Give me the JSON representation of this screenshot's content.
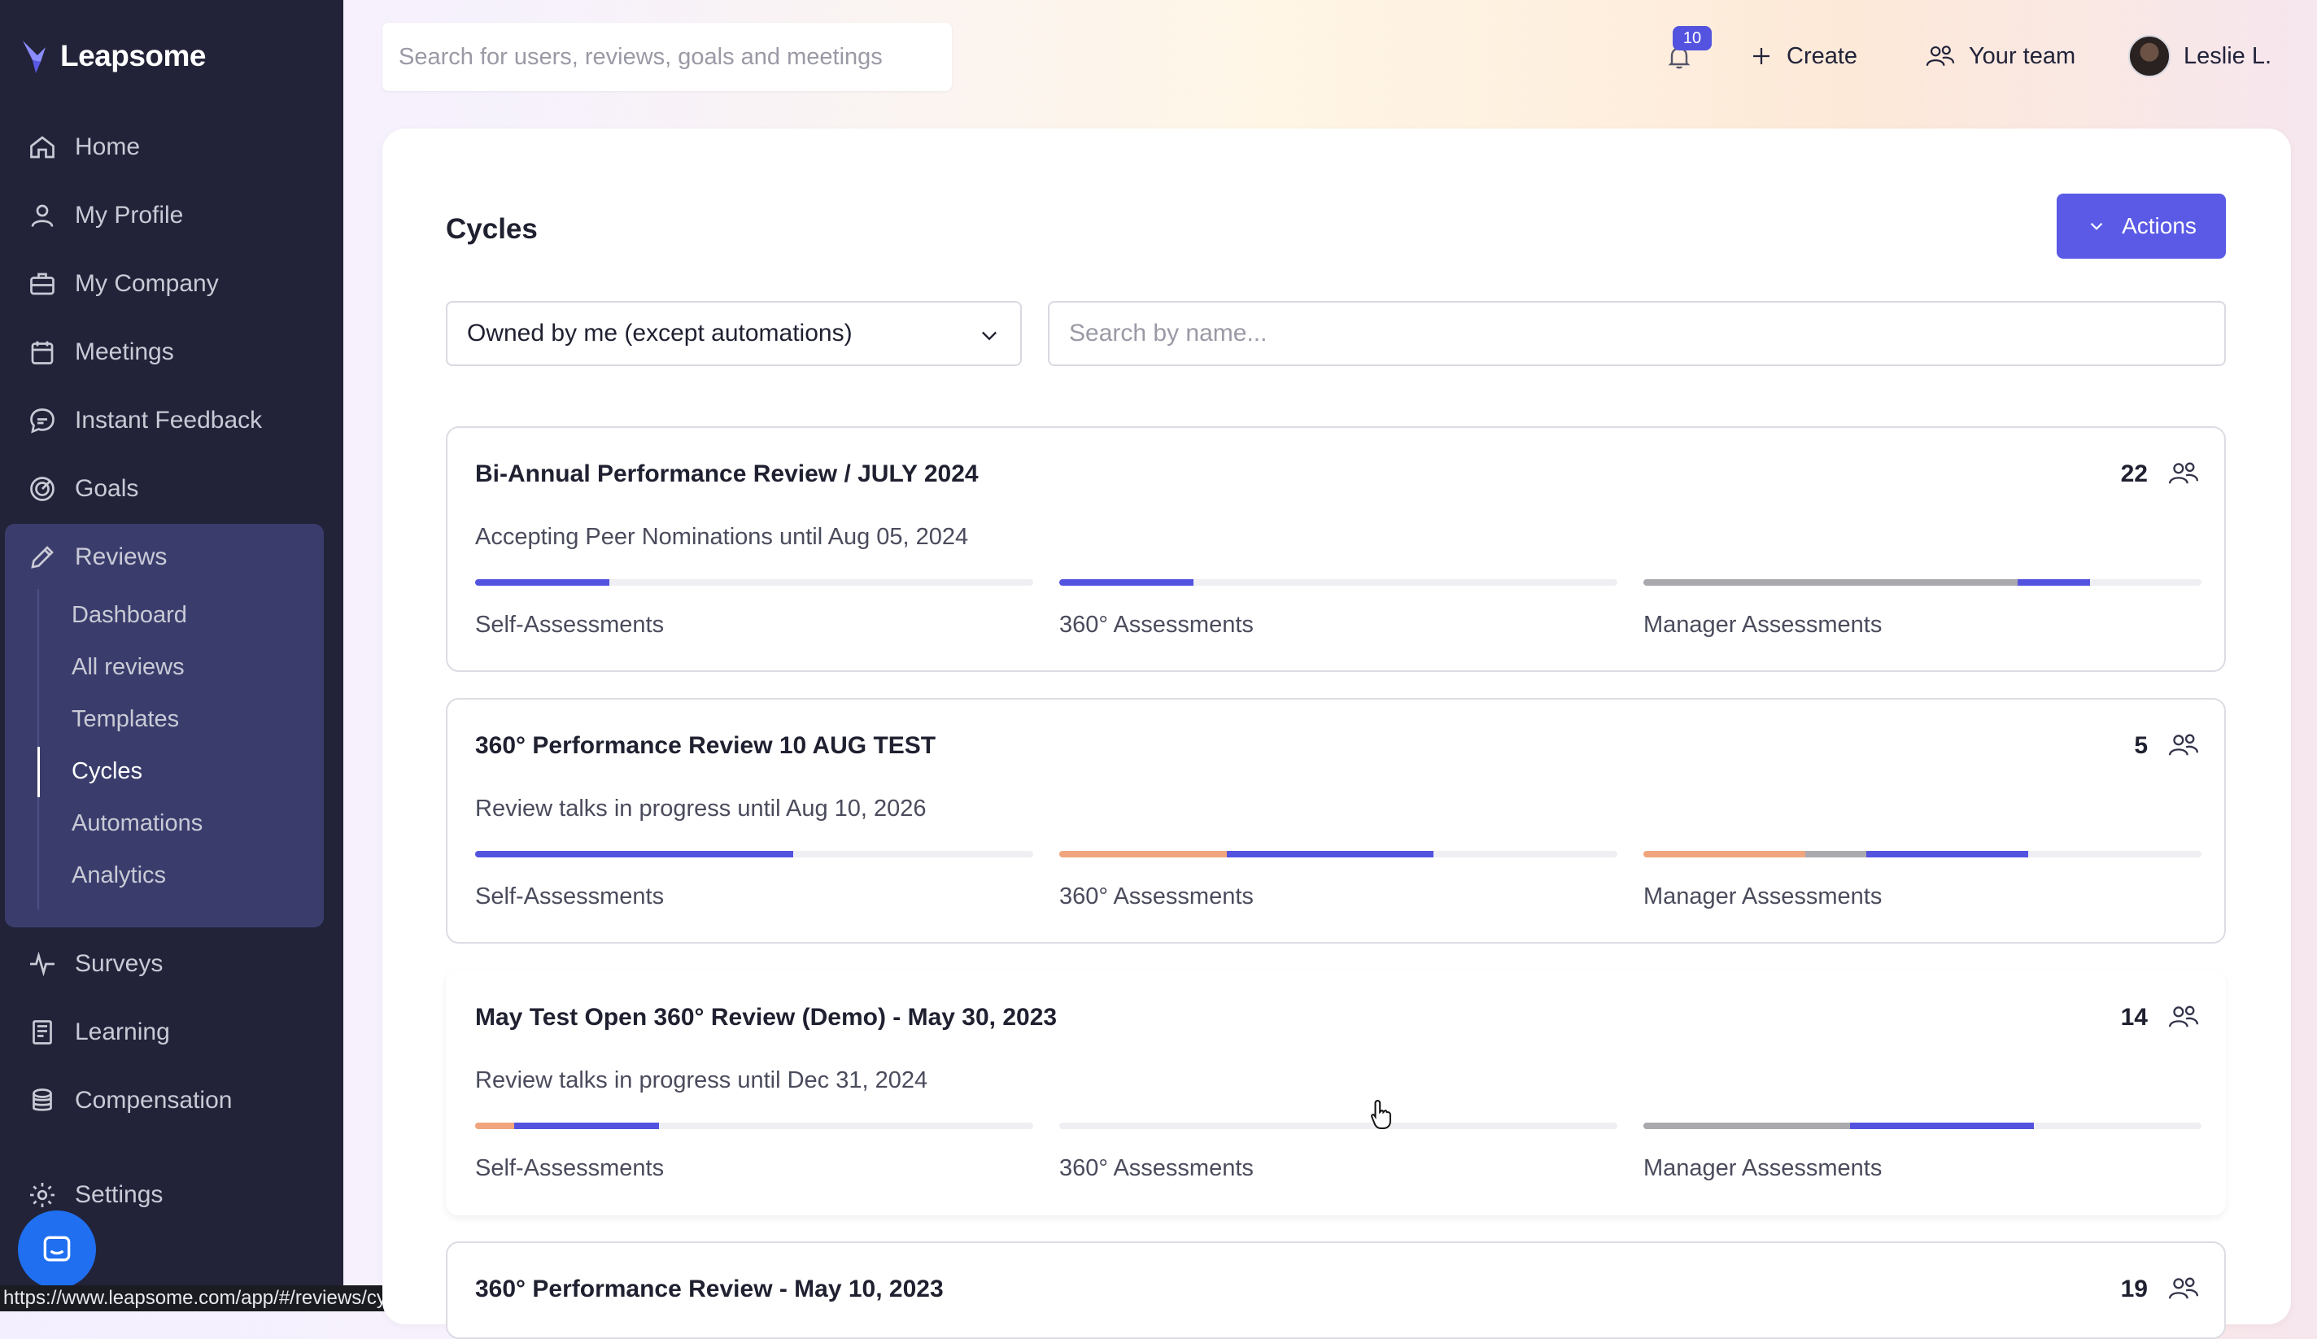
{
  "app": {
    "name": "Leapsome"
  },
  "sidebar": {
    "items": [
      {
        "label": "Home",
        "icon": "home-icon"
      },
      {
        "label": "My Profile",
        "icon": "user-icon"
      },
      {
        "label": "My Company",
        "icon": "briefcase-icon"
      },
      {
        "label": "Meetings",
        "icon": "calendar-icon"
      },
      {
        "label": "Instant Feedback",
        "icon": "chat-icon"
      },
      {
        "label": "Goals",
        "icon": "target-icon"
      },
      {
        "label": "Reviews",
        "icon": "pencil-icon"
      },
      {
        "label": "Surveys",
        "icon": "pulse-icon"
      },
      {
        "label": "Learning",
        "icon": "book-icon"
      },
      {
        "label": "Compensation",
        "icon": "coins-icon"
      },
      {
        "label": "Settings",
        "icon": "gear-icon"
      }
    ],
    "reviews_sub": [
      "Dashboard",
      "All reviews",
      "Templates",
      "Cycles",
      "Automations",
      "Analytics"
    ],
    "active_sub": "Cycles"
  },
  "topbar": {
    "search_placeholder": "Search for users, reviews, goals and meetings",
    "notifications": "10",
    "create_label": "Create",
    "team_label": "Your team",
    "user_name": "Leslie L."
  },
  "page": {
    "title": "Cycles",
    "actions_label": "Actions",
    "filter_value": "Owned by me (except automations)",
    "name_search_placeholder": "Search by name..."
  },
  "colors": {
    "accent": "#5a5ae6",
    "progress_blue": "#5353e0",
    "progress_orange": "#f0a57e",
    "progress_gray": "#a9a9ae",
    "sidebar_bg": "#222338"
  },
  "cycles": [
    {
      "title": "Bi-Annual Performance Review / JULY 2024",
      "count": "22",
      "status": "Accepting Peer Nominations until Aug 05, 2024",
      "bars": [
        {
          "label": "Self-Assessments",
          "segments": [
            {
              "color": "blue",
              "fraction": 0.24
            }
          ]
        },
        {
          "label": "360° Assessments",
          "segments": [
            {
              "color": "blue",
              "fraction": 0.24
            }
          ]
        },
        {
          "label": "Manager Assessments",
          "segments": [
            {
              "color": "gray",
              "fraction": 0.67
            },
            {
              "color": "blue",
              "fraction": 0.13
            }
          ]
        }
      ]
    },
    {
      "title": "360° Performance Review 10 AUG TEST",
      "count": "5",
      "status": "Review talks in progress until Aug 10, 2026",
      "bars": [
        {
          "label": "Self-Assessments",
          "segments": [
            {
              "color": "blue",
              "fraction": 0.57
            }
          ]
        },
        {
          "label": "360° Assessments",
          "segments": [
            {
              "color": "orange",
              "fraction": 0.3
            },
            {
              "color": "blue",
              "fraction": 0.37
            }
          ]
        },
        {
          "label": "Manager Assessments",
          "segments": [
            {
              "color": "orange",
              "fraction": 0.29
            },
            {
              "color": "gray",
              "fraction": 0.11
            },
            {
              "color": "blue",
              "fraction": 0.29
            }
          ]
        }
      ]
    },
    {
      "title": "May Test Open 360° Review (Demo) - May 30, 2023",
      "count": "14",
      "status": "Review talks in progress until Dec 31, 2024",
      "bars": [
        {
          "label": "Self-Assessments",
          "segments": [
            {
              "color": "orange",
              "fraction": 0.07
            },
            {
              "color": "blue",
              "fraction": 0.26
            }
          ]
        },
        {
          "label": "360° Assessments",
          "segments": []
        },
        {
          "label": "Manager Assessments",
          "segments": [
            {
              "color": "gray",
              "fraction": 0.37
            },
            {
              "color": "blue",
              "fraction": 0.33
            }
          ]
        }
      ]
    },
    {
      "title": "360° Performance Review - May 10, 2023",
      "count": "19"
    }
  ],
  "status_bar": {
    "url": "https://www.leapsome.com/app/#/reviews/cycles/edit/6475a8f9a7bf7c9d7bc49d..."
  }
}
